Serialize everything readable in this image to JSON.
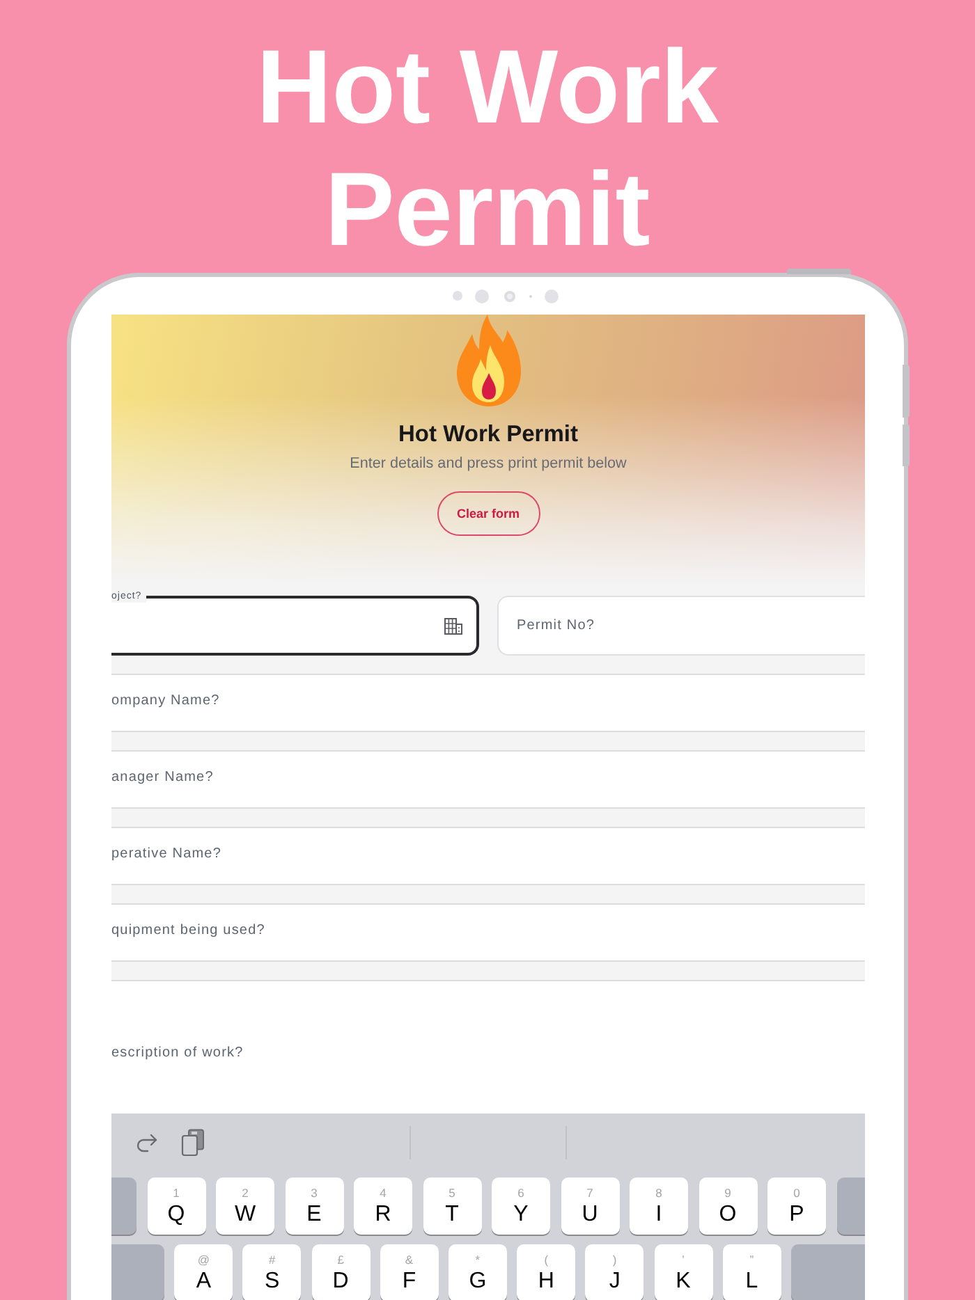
{
  "promo": {
    "title": "Hot Work Permit"
  },
  "header": {
    "title": "Hot Work Permit",
    "subtitle": "Enter details and press print permit below",
    "clear_button": "Clear form"
  },
  "fields": [
    {
      "kind": "select",
      "label": "oject?",
      "focused": true
    },
    {
      "kind": "half",
      "placeholder": "Permit No?",
      "focused": false
    },
    {
      "kind": "line",
      "placeholder": "ompany Name?",
      "focused": false
    },
    {
      "kind": "line",
      "placeholder": "anager Name?",
      "focused": false
    },
    {
      "kind": "line",
      "placeholder": "perative Name?",
      "focused": false
    },
    {
      "kind": "line",
      "placeholder": "quipment being used?",
      "focused": false
    },
    {
      "kind": "area",
      "placeholder": "escription of work?",
      "focused": false
    }
  ],
  "keyboard": {
    "rows": [
      {
        "keys": [
          {
            "kind": "modifier"
          },
          {
            "kind": "letter",
            "hint": "1",
            "label": "Q"
          },
          {
            "kind": "letter",
            "hint": "2",
            "label": "W"
          },
          {
            "kind": "letter",
            "hint": "3",
            "label": "E"
          },
          {
            "kind": "letter",
            "hint": "4",
            "label": "R"
          },
          {
            "kind": "letter",
            "hint": "5",
            "label": "T"
          },
          {
            "kind": "letter",
            "hint": "6",
            "label": "Y"
          },
          {
            "kind": "letter",
            "hint": "7",
            "label": "U"
          },
          {
            "kind": "letter",
            "hint": "8",
            "label": "I"
          },
          {
            "kind": "letter",
            "hint": "9",
            "label": "O"
          },
          {
            "kind": "letter",
            "hint": "0",
            "label": "P"
          },
          {
            "kind": "modifier"
          }
        ]
      },
      {
        "keys": [
          {
            "kind": "modifier"
          },
          {
            "kind": "letter",
            "hint": "@",
            "label": "A"
          },
          {
            "kind": "letter",
            "hint": "#",
            "label": "S"
          },
          {
            "kind": "letter",
            "hint": "£",
            "label": "D"
          },
          {
            "kind": "letter",
            "hint": "&",
            "label": "F"
          },
          {
            "kind": "letter",
            "hint": "*",
            "label": "G"
          },
          {
            "kind": "letter",
            "hint": "(",
            "label": "H"
          },
          {
            "kind": "letter",
            "hint": ")",
            "label": "J"
          },
          {
            "kind": "letter",
            "hint": "’",
            "label": "K"
          },
          {
            "kind": "letter",
            "hint": "”",
            "label": "L"
          },
          {
            "kind": "modifier"
          }
        ]
      }
    ]
  }
}
